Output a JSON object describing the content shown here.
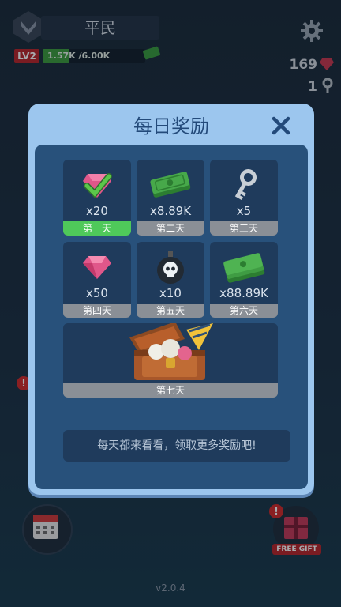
{
  "hud": {
    "rank_title": "平民",
    "level": "LV2",
    "xp_text": "1.57K /6.00K",
    "xp_progress": 0.26,
    "gems": "169",
    "keys": "1"
  },
  "dialog": {
    "title": "每日奖励",
    "rewards": [
      {
        "icon": "checked-gem-icon",
        "qty": "x20",
        "day": "第一天",
        "claimed": true
      },
      {
        "icon": "cash-stack-icon",
        "qty": "x8.89K",
        "day": "第二天",
        "claimed": false
      },
      {
        "icon": "key-icon",
        "qty": "x5",
        "day": "第三天",
        "claimed": false
      },
      {
        "icon": "gem-icon",
        "qty": "x50",
        "day": "第四天",
        "claimed": false
      },
      {
        "icon": "skull-bomb-icon",
        "qty": "x10",
        "day": "第五天",
        "claimed": false
      },
      {
        "icon": "cash-stack-icon",
        "qty": "x88.89K",
        "day": "第六天",
        "claimed": false
      }
    ],
    "day7": {
      "icon": "treasure-chest-icon",
      "day": "第七天"
    },
    "tip": "每天都来看看，领取更多奖励吧!"
  },
  "bottom": {
    "free_gift_label": "FREE GIFT",
    "alert_mark": "!",
    "version": "v2.0.4"
  },
  "colors": {
    "panel": "#9cc6ee",
    "inner": "#28517b",
    "cell": "#1f3b5c",
    "claimed": "#4fc95a",
    "unclaimed": "#8a8f96",
    "title": "#234a7a"
  }
}
